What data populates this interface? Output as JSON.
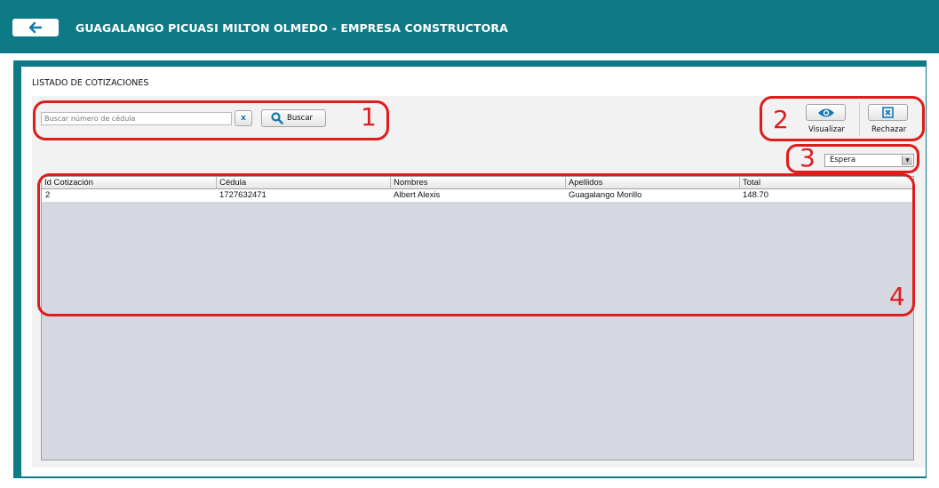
{
  "header": {
    "title": "GUAGALANGO PICUASI MILTON OLMEDO - EMPRESA CONSTRUCTORA",
    "back_icon": "arrow-left-icon"
  },
  "page": {
    "section_title": "LISTADO DE COTIZACIONES"
  },
  "search": {
    "placeholder": "Buscar número de cédula",
    "clear_label": "x",
    "button_label": "Buscar",
    "button_icon": "search-icon"
  },
  "toolbar": {
    "view_label": "Visualizar",
    "view_icon": "eye-icon",
    "reject_label": "Rechazar",
    "reject_icon": "close-box-icon"
  },
  "status_filter": {
    "selected": "Espera"
  },
  "table": {
    "columns": [
      "Id Cotización",
      "Cédula",
      "Nombres",
      "Apellidos",
      "Total"
    ],
    "rows": [
      [
        "2",
        "1727632471",
        "Albert Alexis",
        "Guagalango Morillo",
        "148.70"
      ]
    ]
  },
  "annotations": [
    "1",
    "2",
    "3",
    "4"
  ],
  "colors": {
    "header_bg": "#0e7a86",
    "annotation": "#e01b1b",
    "grid_bg": "#d5d8e0"
  }
}
